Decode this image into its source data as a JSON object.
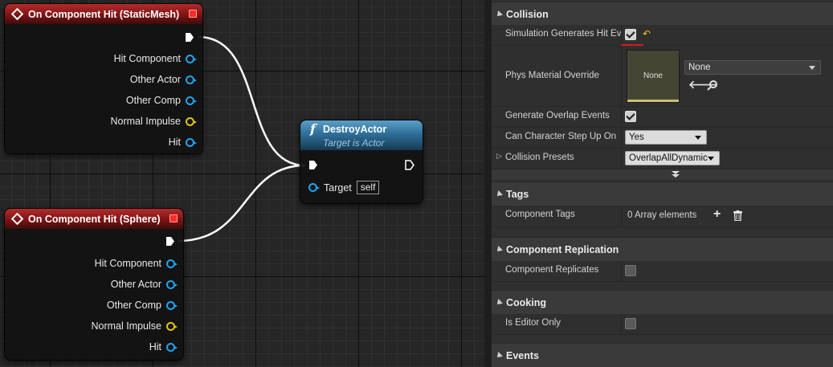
{
  "graph": {
    "node_staticmesh": {
      "title": "On Component Hit (StaticMesh)",
      "pins": [
        "Hit Component",
        "Other Actor",
        "Other Comp",
        "Normal Impulse",
        "Hit"
      ]
    },
    "node_sphere": {
      "title": "On Component Hit (Sphere)",
      "pins": [
        "Hit Component",
        "Other Actor",
        "Other Comp",
        "Normal Impulse",
        "Hit"
      ]
    },
    "node_destroy": {
      "icon": "f",
      "title": "DestroyActor",
      "subtitle": "Target is Actor",
      "target_label": "Target",
      "target_default": "self"
    },
    "colors": {
      "event_header": "#8a1616",
      "function_header": "#3a7db0",
      "object_pin": "#1fa5f0",
      "struct_pin": "#e3c312",
      "exec_wire": "#ffffff"
    }
  },
  "details": {
    "collision": {
      "title": "Collision",
      "sim_hit_label": "Simulation Generates Hit Eve",
      "sim_hit_checked": true,
      "phys_label": "Phys Material Override",
      "phys_thumb": "None",
      "phys_combo": "None",
      "overlap_label": "Generate Overlap Events",
      "overlap_checked": true,
      "step_label": "Can Character Step Up On",
      "step_value": "Yes",
      "presets_label": "Collision Presets",
      "presets_value": "OverlapAllDynamic"
    },
    "tags": {
      "title": "Tags",
      "component_tags_label": "Component Tags",
      "component_tags_value": "0 Array elements"
    },
    "replication": {
      "title": "Component Replication",
      "replicates_label": "Component Replicates",
      "replicates_checked": false
    },
    "cooking": {
      "title": "Cooking",
      "editor_only_label": "Is Editor Only",
      "editor_only_checked": false
    },
    "events": {
      "title": "Events"
    }
  }
}
